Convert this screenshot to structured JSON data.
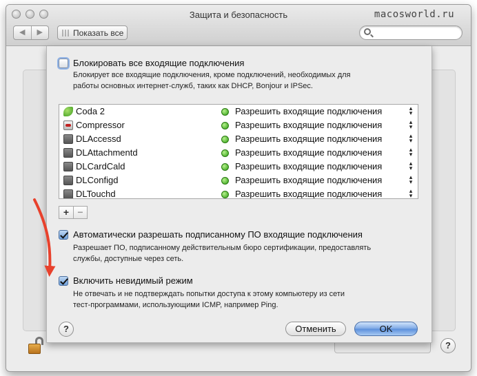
{
  "window": {
    "title": "Защита и безопасность",
    "watermark": "macosworld.ru",
    "nav_back": "◀",
    "nav_forward": "▶",
    "show_all": "Показать все",
    "search_placeholder": ""
  },
  "sheet": {
    "block_all": {
      "label": "Блокировать все входящие подключения",
      "checked": false,
      "description_line1": "Блокирует все входящие подключения, кроме подключений, необходимых для",
      "description_line2": "работы основных интернет-служб, таких как DHCP, Bonjour и IPSec."
    },
    "apps": [
      {
        "name": "Coda 2",
        "icon": "coda-icon",
        "status": "Разрешить входящие подключения",
        "status_color": "#2d9f12"
      },
      {
        "name": "Compressor",
        "icon": "compressor-icon",
        "status": "Разрешить входящие подключения",
        "status_color": "#2d9f12"
      },
      {
        "name": "DLAccessd",
        "icon": "generic-app-icon",
        "status": "Разрешить входящие подключения",
        "status_color": "#2d9f12"
      },
      {
        "name": "DLAttachmentd",
        "icon": "generic-app-icon",
        "status": "Разрешить входящие подключения",
        "status_color": "#2d9f12"
      },
      {
        "name": "DLCardCald",
        "icon": "generic-app-icon",
        "status": "Разрешить входящие подключения",
        "status_color": "#2d9f12"
      },
      {
        "name": "DLConfigd",
        "icon": "generic-app-icon",
        "status": "Разрешить входящие подключения",
        "status_color": "#2d9f12"
      },
      {
        "name": "DLTouchd",
        "icon": "generic-app-icon",
        "status": "Разрешить входящие подключения",
        "status_color": "#2d9f12"
      }
    ],
    "stepper_glyph": "▴\n▾",
    "add_button": "+",
    "remove_button": "−",
    "auto_allow": {
      "label": "Автоматически разрешать подписанному ПО входящие подключения",
      "checked": true,
      "description_line1": "Разрешает ПО, подписанному действительным бюро сертификации, предоставлять",
      "description_line2": "службы, доступные через сеть."
    },
    "stealth": {
      "label": "Включить невидимый режим",
      "checked": true,
      "description_line1": "Не отвечать и не подтверждать попытки доступа к этому компьютеру из сети",
      "description_line2": "тест-программами, использующими ICMP, например Ping."
    },
    "help_button": "?",
    "cancel_button": "Отменить",
    "ok_button": "OK"
  },
  "background": {
    "help_button": "?"
  },
  "accent_color": "#e8412c"
}
